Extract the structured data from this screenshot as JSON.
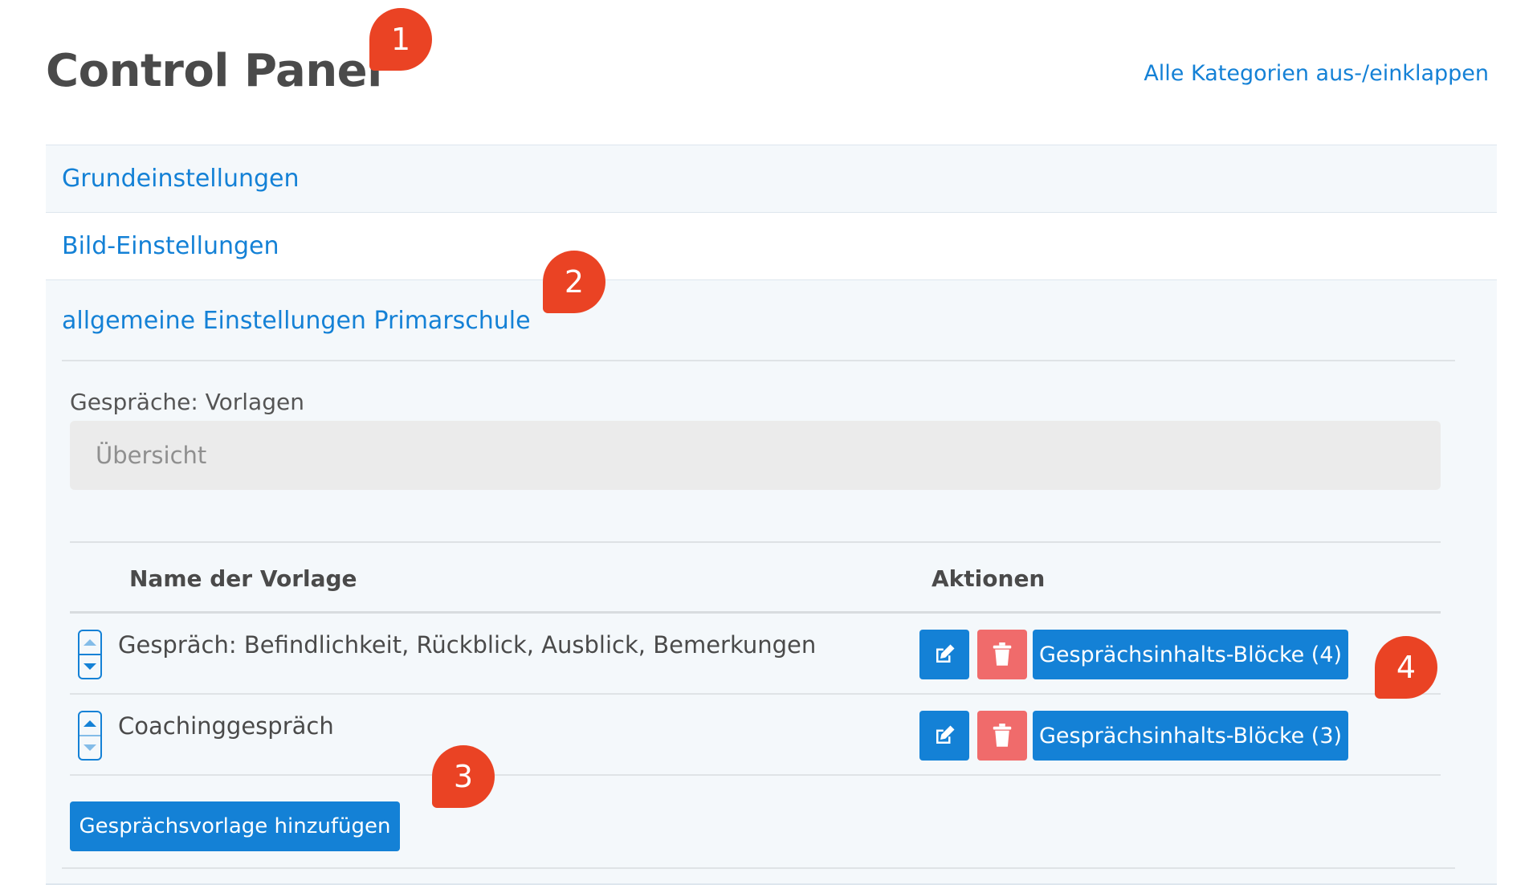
{
  "header": {
    "title": "Control Panel",
    "toggle_all_label": "Alle Kategorien aus-/einklappen"
  },
  "callouts": [
    "1",
    "2",
    "3",
    "4"
  ],
  "categories": [
    {
      "label": "Grundeinstellungen"
    },
    {
      "label": "Bild-Einstellungen"
    },
    {
      "label": "allgemeine Einstellungen Primarschule"
    }
  ],
  "section": {
    "label": "Gespräche: Vorlagen",
    "overview_placeholder": "Übersicht"
  },
  "table": {
    "columns": [
      "Name der Vorlage",
      "Aktionen"
    ],
    "rows": [
      {
        "name": "Gespräch: Befindlichkeit, Rückblick, Ausblick, Bemerkungen",
        "blocks_label": "Gesprächsinhalts-Blöcke (4)"
      },
      {
        "name": "Coachinggespräch",
        "blocks_label": "Gesprächsinhalts-Blöcke (3)"
      }
    ]
  },
  "add_button_label": "Gesprächsvorlage hinzufügen",
  "colors": {
    "link": "#1481d6",
    "primary_button": "#1481d6",
    "danger_button": "#f06b6b",
    "callout": "#ea4324",
    "panel_background": "#f4f8fb"
  },
  "icons": {
    "edit": "edit-icon",
    "delete": "trash-icon",
    "move_up": "arrow-up-icon",
    "move_down": "arrow-down-icon"
  }
}
